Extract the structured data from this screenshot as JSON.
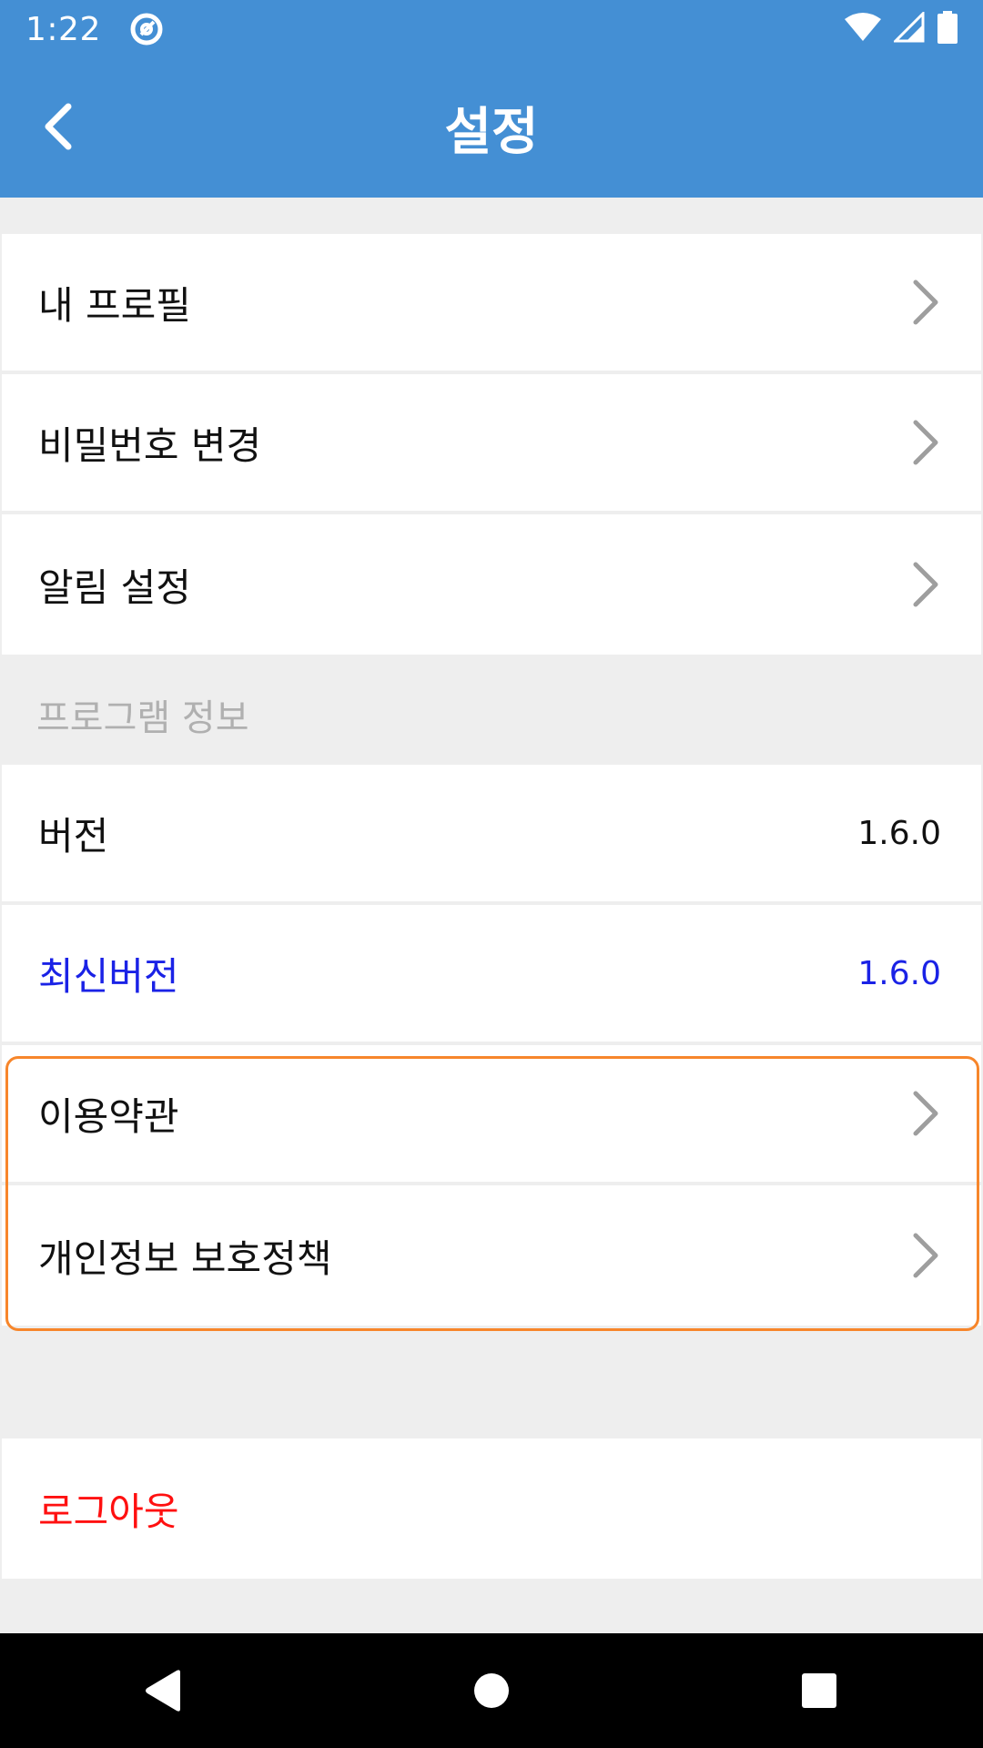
{
  "status_bar": {
    "time": "1:22"
  },
  "app_bar": {
    "title": "설정"
  },
  "account_items": [
    {
      "label": "내 프로필"
    },
    {
      "label": "비밀번호 변경"
    },
    {
      "label": "알림 설정"
    }
  ],
  "program_section": {
    "header": "프로그램 정보",
    "version": {
      "label": "버전",
      "value": "1.6.0"
    },
    "latest_version": {
      "label": "최신버전",
      "value": "1.6.0"
    }
  },
  "legal_items": [
    {
      "label": "이용약관"
    },
    {
      "label": "개인정보 보호정책"
    }
  ],
  "logout": {
    "label": "로그아웃"
  },
  "colors": {
    "app_bar": "#448fd4",
    "latest_version_text": "#1a22e6",
    "logout_text": "#ff1010",
    "highlight_border": "#f7862b"
  }
}
